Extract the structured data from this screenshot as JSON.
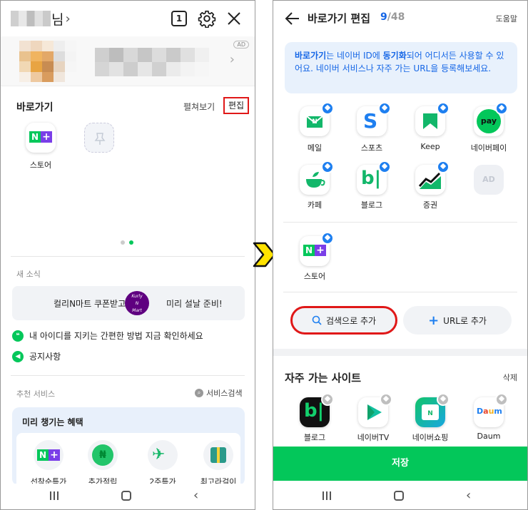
{
  "left_screen": {
    "header": {
      "name_suffix": "님",
      "name_chevron": "›",
      "tab_count": "1"
    },
    "ad": {
      "tag": "AD"
    },
    "shortcuts": {
      "title": "바로가기",
      "expand_label": "펼쳐보기",
      "edit_label": "편집",
      "items": [
        {
          "label": "스토어",
          "icon": "naver-plus-store-icon"
        }
      ]
    },
    "news": {
      "title": "새 소식",
      "banner_left": "컬리N마트 쿠폰받고",
      "banner_right": "미리 설날 준비!",
      "banner_logo": "Kurly N Mart",
      "item1": "내 아이디를 지키는 간편한 방법 지금 확인하세요",
      "item2": "공지사항"
    },
    "recommend": {
      "title": "추천 서비스",
      "search_label": "서비스검색",
      "benefit_title": "미리 챙기는 혜택",
      "benefit_items": [
        "선착순특가",
        "추가적립",
        "2주특가",
        "최고라걸이"
      ]
    }
  },
  "right_screen": {
    "header": {
      "title": "바로가기 편집",
      "count": "9",
      "total": "/48",
      "help": "도움말"
    },
    "info_text": {
      "part1": "바로가기",
      "part2": "는 네이버 ID에 ",
      "part3": "동기화",
      "part4": "되어 어디서든 사용할 수 있어요. 네이버 서비스나 자주 가는 URL을 등록해보세요."
    },
    "apps": [
      {
        "label": "메일",
        "icon": "mail-icon"
      },
      {
        "label": "스포츠",
        "icon": "sports-icon"
      },
      {
        "label": "Keep",
        "icon": "keep-icon"
      },
      {
        "label": "네이버페이",
        "icon": "naver-pay-icon"
      },
      {
        "label": "카페",
        "icon": "cafe-icon"
      },
      {
        "label": "블로그",
        "icon": "blog-icon"
      },
      {
        "label": "증권",
        "icon": "stock-icon"
      },
      {
        "label": "스토어",
        "icon": "naver-plus-store-icon"
      }
    ],
    "ad_slot": "AD",
    "add_search_label": "검색으로 추가",
    "add_url_label": "URL로 추가",
    "frequent": {
      "title": "자주 가는 사이트",
      "delete_label": "삭제",
      "items": [
        {
          "label": "블로그",
          "icon": "blog-icon"
        },
        {
          "label": "네이버TV",
          "icon": "naver-tv-icon"
        },
        {
          "label": "네이버쇼핑",
          "icon": "naver-shopping-icon"
        },
        {
          "label": "Daum",
          "icon": "daum-icon"
        }
      ]
    },
    "save_label": "저장"
  },
  "colors": {
    "naver_green": "#03c75a",
    "accent_blue": "#1566e6",
    "highlight_red": "#e01818",
    "arrow_yellow": "#ffe200"
  }
}
